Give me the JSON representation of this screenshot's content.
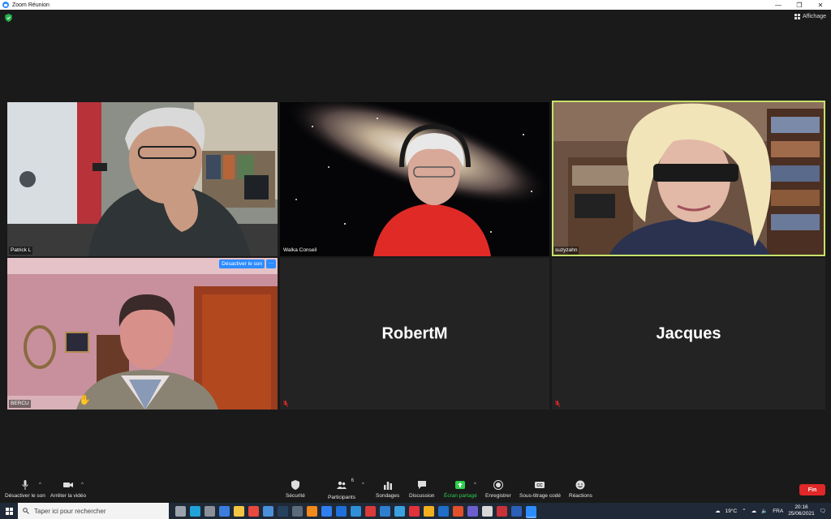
{
  "window": {
    "title": "Zoom Réunion"
  },
  "top": {
    "view_label": "Affichage"
  },
  "tiles": [
    {
      "name": "Patrick L",
      "type": "video"
    },
    {
      "name": "Walka Conseil",
      "type": "video"
    },
    {
      "name": "suzyzahn",
      "type": "video",
      "speaking": true
    },
    {
      "name": "BERCU",
      "type": "video",
      "unmute_label": "Désactiver le son",
      "more_label": "···"
    },
    {
      "name": "RobertM",
      "type": "name-only"
    },
    {
      "name": "Jacques",
      "type": "name-only"
    }
  ],
  "toolbar": {
    "mute_label": "Désactiver le son",
    "video_label": "Arrêter la vidéo",
    "security_label": "Sécurité",
    "participants_label": "Participants",
    "participants_count": "6",
    "polls_label": "Sondages",
    "chat_label": "Discussion",
    "share_label": "Écran partagé",
    "record_label": "Enregistrer",
    "cc_label": "Sous-titrage codé",
    "reactions_label": "Réactions",
    "end_label": "Fin",
    "caret": "^"
  },
  "taskbar": {
    "search_placeholder": "Taper ici pour rechercher",
    "weather": "19°C",
    "language": "FRA",
    "time": "20:16",
    "date": "25/06/2021",
    "apps": [
      {
        "icon": "task-view-icon",
        "color": "#9aa3ad"
      },
      {
        "icon": "edge-icon",
        "color": "#1fa3d8"
      },
      {
        "icon": "app-icon",
        "color": "#8a8f99"
      },
      {
        "icon": "store-icon",
        "color": "#3b7ddd"
      },
      {
        "icon": "folder-icon",
        "color": "#f4c542"
      },
      {
        "icon": "chrome-icon",
        "color": "#e9483f"
      },
      {
        "icon": "photos-icon",
        "color": "#4a90d9"
      },
      {
        "icon": "photoshop-icon",
        "color": "#26415e"
      },
      {
        "icon": "app-icon",
        "color": "#5b6b7c"
      },
      {
        "icon": "vlc-icon",
        "color": "#f08a1c"
      },
      {
        "icon": "dropbox-icon",
        "color": "#2f7ff0"
      },
      {
        "icon": "app-icon",
        "color": "#1e6fd9"
      },
      {
        "icon": "app-icon",
        "color": "#2f8fd9"
      },
      {
        "icon": "antivirus-icon",
        "color": "#d93a3a"
      },
      {
        "icon": "mail-icon",
        "color": "#2f7fd0"
      },
      {
        "icon": "app-icon",
        "color": "#3aa0e0"
      },
      {
        "icon": "opera-icon",
        "color": "#e0323a"
      },
      {
        "icon": "app-icon",
        "color": "#f2b01e"
      },
      {
        "icon": "outlook-icon",
        "color": "#1f6fc8"
      },
      {
        "icon": "office-icon",
        "color": "#e0502a"
      },
      {
        "icon": "app-icon",
        "color": "#6b5fd0"
      },
      {
        "icon": "app-icon",
        "color": "#d8d8d8"
      },
      {
        "icon": "app-icon",
        "color": "#c8323a"
      },
      {
        "icon": "word-icon",
        "color": "#2b5fb8"
      },
      {
        "icon": "zoom-icon",
        "color": "#2d8cff",
        "active": true
      }
    ]
  }
}
